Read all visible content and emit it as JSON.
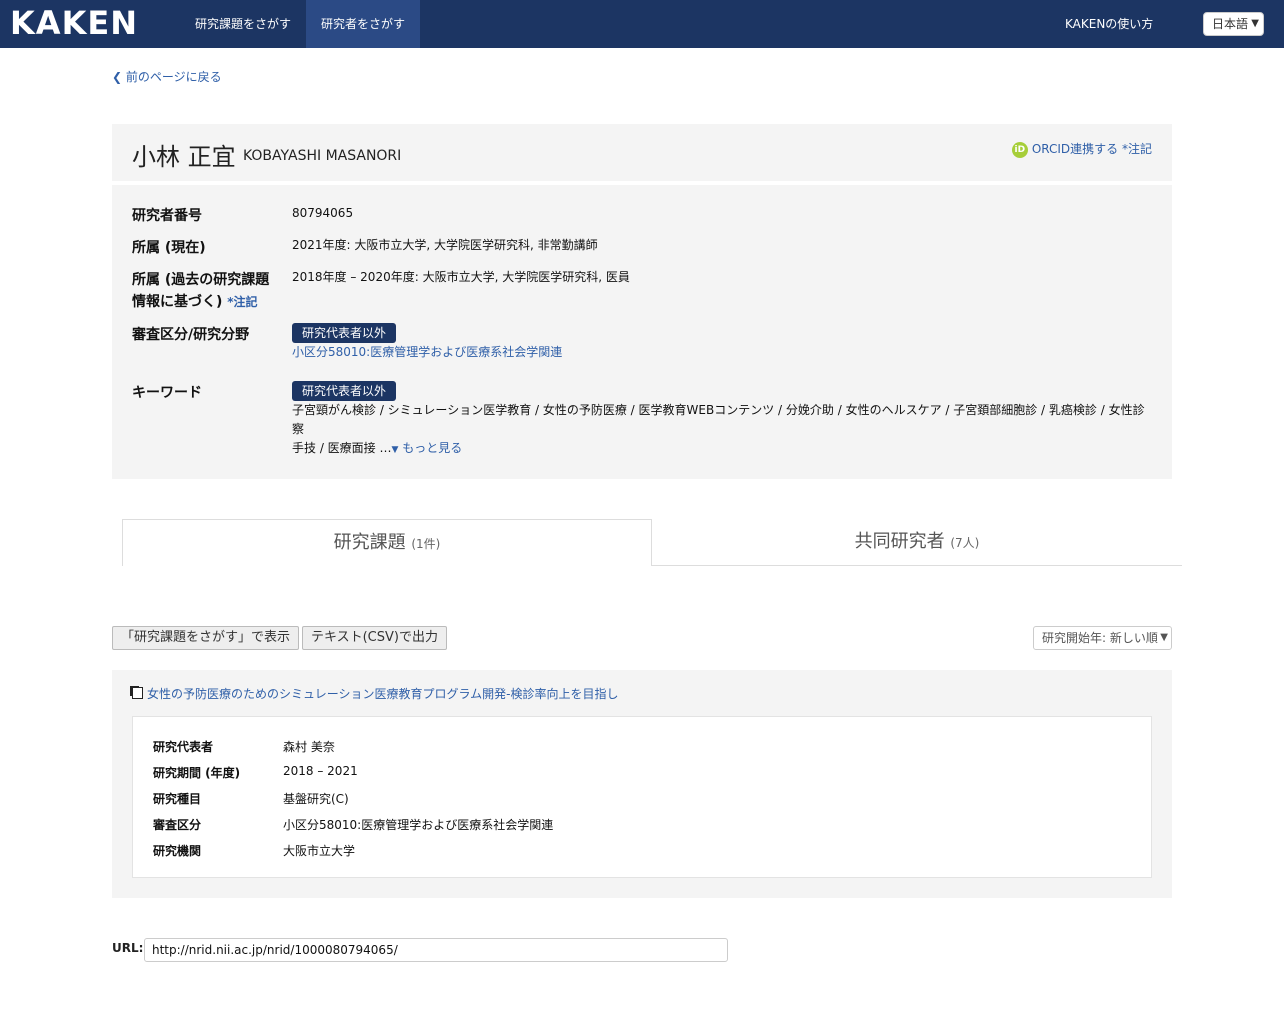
{
  "header": {
    "logo": "KAKEN",
    "nav": [
      "研究課題をさがす",
      "研究者をさがす"
    ],
    "active_nav": 1,
    "help": "KAKENの使い方",
    "language": "日本語"
  },
  "back_link": "前のページに戻る",
  "researcher": {
    "name_jp": "小林 正宜",
    "name_en": "KOBAYASHI MASANORI",
    "orcid": "ORCID連携する *注記"
  },
  "info": {
    "number_label": "研究者番号",
    "number": "80794065",
    "affil_current_label": "所属 (現在)",
    "affil_current": "2021年度: 大阪市立大学, 大学院医学研究科, 非常勤講師",
    "affil_past_label": "所属 (過去の研究課題情報に基づく)",
    "affil_past_note": "*注記",
    "affil_past": "2018年度 – 2020年度: 大阪市立大学, 大学院医学研究科, 医員",
    "field_label": "審査区分/研究分野",
    "field_badge": "研究代表者以外",
    "field_link": "小区分58010:医療管理学および医療系社会学関連",
    "keyword_label": "キーワード",
    "keyword_badge": "研究代表者以外",
    "keywords_line1": "子宮頸がん検診 / シミュレーション医学教育 / 女性の予防医療 / 医学教育WEBコンテンツ / 分娩介助 / 女性のヘルスケア / 子宮頚部細胞診 / 乳癌検診 / 女性診察",
    "keywords_line2": "手技 / 医療面接 …",
    "more": "もっと見る"
  },
  "tabs": [
    {
      "label": "研究課題",
      "count": "(1件)"
    },
    {
      "label": "共同研究者",
      "count": "(7人)"
    }
  ],
  "actions": {
    "search_button": "「研究課題をさがす」で表示",
    "csv_button": "テキスト(CSV)で出力",
    "sort": "研究開始年: 新しい順"
  },
  "project": {
    "title": "女性の予防医療のためのシミュレーション医療教育プログラム開発-検診率向上を目指し",
    "rows": [
      {
        "label": "研究代表者",
        "value": "森村 美奈",
        "link": true
      },
      {
        "label": "研究期間 (年度)",
        "value": "2018 – 2021",
        "link": false
      },
      {
        "label": "研究種目",
        "value": "基盤研究(C)",
        "link": true
      },
      {
        "label": "審査区分",
        "value": "小区分58010:医療管理学および医療系社会学関連",
        "link": true
      },
      {
        "label": "研究機関",
        "value": "大阪市立大学",
        "link": true
      }
    ]
  },
  "url": {
    "label": "URL:",
    "value": "http://nrid.nii.ac.jp/nrid/1000080794065/"
  }
}
